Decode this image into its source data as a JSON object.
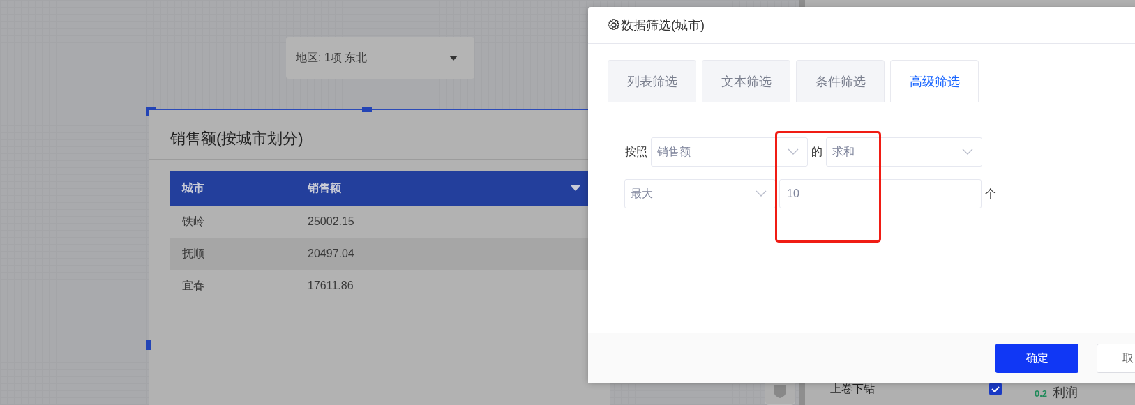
{
  "filter_dropdown": {
    "label": "地区: 1项 东北"
  },
  "table_card": {
    "title": "销售额(按城市划分)",
    "columns": [
      "城市",
      "销售额"
    ],
    "rows": [
      {
        "cells": [
          "铁岭",
          "25002.15"
        ]
      },
      {
        "cells": [
          "抚顺",
          "20497.04"
        ]
      },
      {
        "cells": [
          "宜春",
          "17611.86"
        ]
      }
    ]
  },
  "side_panel": {
    "items": [
      {
        "label": "上卷下钻",
        "checked": true
      }
    ],
    "metric": {
      "value": "0.2",
      "label": "利润"
    }
  },
  "dialog": {
    "title": "数据筛选(城市)",
    "tabs": [
      {
        "label": "列表筛选",
        "selected": false
      },
      {
        "label": "文本筛选",
        "selected": false
      },
      {
        "label": "条件筛选",
        "selected": false
      },
      {
        "label": "高级筛选",
        "selected": true
      }
    ],
    "form": {
      "prefix": "按照",
      "field": "销售额",
      "connector": "的",
      "aggregate": "求和",
      "order": "最大",
      "count": "10",
      "unit": "个"
    },
    "buttons": [
      {
        "label": "确定",
        "kind": "primary"
      },
      {
        "label": "取",
        "kind": "secondary"
      }
    ]
  }
}
